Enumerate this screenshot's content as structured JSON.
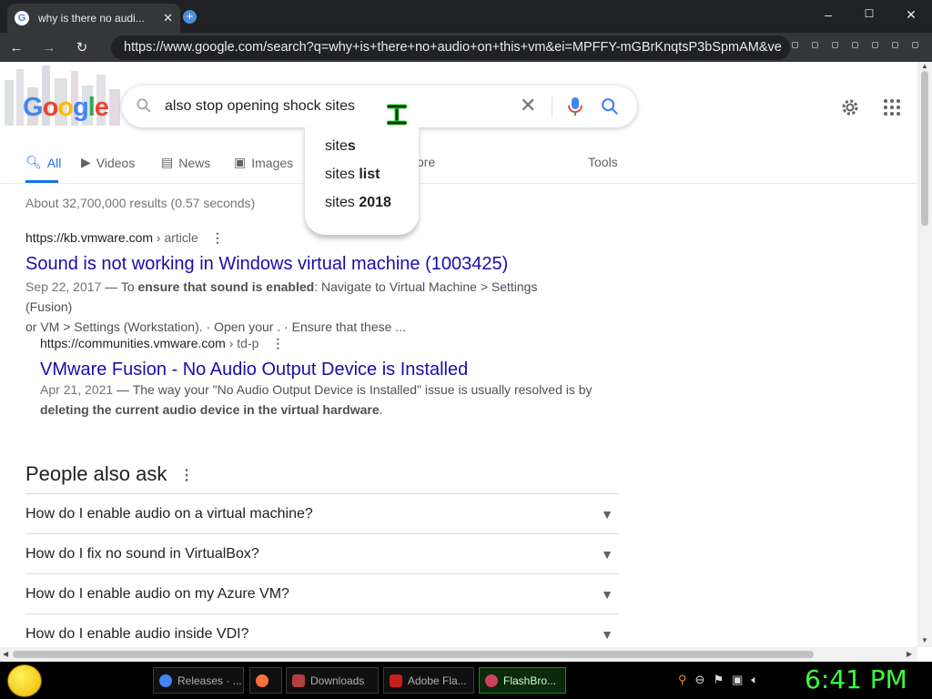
{
  "browser": {
    "tab_title": "why is there no audi...",
    "tab_favicon": "G",
    "new_tab_label": "+",
    "minimize": "–",
    "maximize": "☐",
    "close": "✕",
    "url": "https://www.google.com/search?q=why+is+there+no+audio+on+this+vm&ei=MPFFY-mGBrKnqtsP3bSpmAM&ve"
  },
  "search": {
    "query": "also stop opening shock sites",
    "clear_label": "✕",
    "doodle_text": "Google"
  },
  "suggestions": [
    {
      "prefix": "site",
      "bold": "s"
    },
    {
      "prefix": "sites",
      "bold": " list"
    },
    {
      "prefix": "sites",
      "bold": " 2018"
    }
  ],
  "tabs": {
    "all": "All",
    "videos": "Videos",
    "news": "News",
    "images": "Images",
    "more": "ore",
    "tools": "Tools"
  },
  "stats": "About 32,700,000 results (0.57 seconds)",
  "results": [
    {
      "url": "https://kb.vmware.com",
      "crumb": " › article",
      "title": "Sound is not working in Windows virtual machine (1003425)",
      "date": "Sep 22, 2017",
      "snippet_pre": " — To ",
      "snippet_bold": "ensure that sound is enabled",
      "snippet_post": ": Navigate to Virtual Machine > Settings (Fusion)",
      "snippet_line2": "or VM > Settings (Workstation). · Open your . · Ensure that these ..."
    },
    {
      "url": "https://communities.vmware.com",
      "crumb": " › td-p",
      "title": "VMware Fusion - No Audio Output Device is Installed",
      "date": "Apr 21, 2021",
      "snippet_pre": " — The way your \"No Audio Output Device is Installed\" issue is usually resolved is by",
      "snippet_bold": "deleting the current audio device in the virtual hardware",
      "snippet_post": "."
    }
  ],
  "people_also_ask": {
    "heading": "People also ask",
    "questions": [
      "How do I enable audio on a virtual machine?",
      "How do I fix no sound in VirtualBox?",
      "How do I enable audio on my Azure VM?",
      "How do I enable audio inside VDI?"
    ]
  },
  "taskbar": {
    "items": [
      {
        "label": "Releases · ...",
        "icon": "chrome-icon",
        "color": "#4285f4"
      },
      {
        "label": "",
        "icon": "firefox-icon",
        "color": "#ff7139"
      },
      {
        "label": "Downloads",
        "icon": "folder-icon",
        "color": "#b04040"
      },
      {
        "label": "Adobe Fla...",
        "icon": "flash-icon",
        "color": "#c81e1e"
      },
      {
        "label": "FlashBro...",
        "icon": "flashbrowser-icon",
        "color": "#d04060"
      }
    ],
    "clock": "6:41 PM"
  }
}
